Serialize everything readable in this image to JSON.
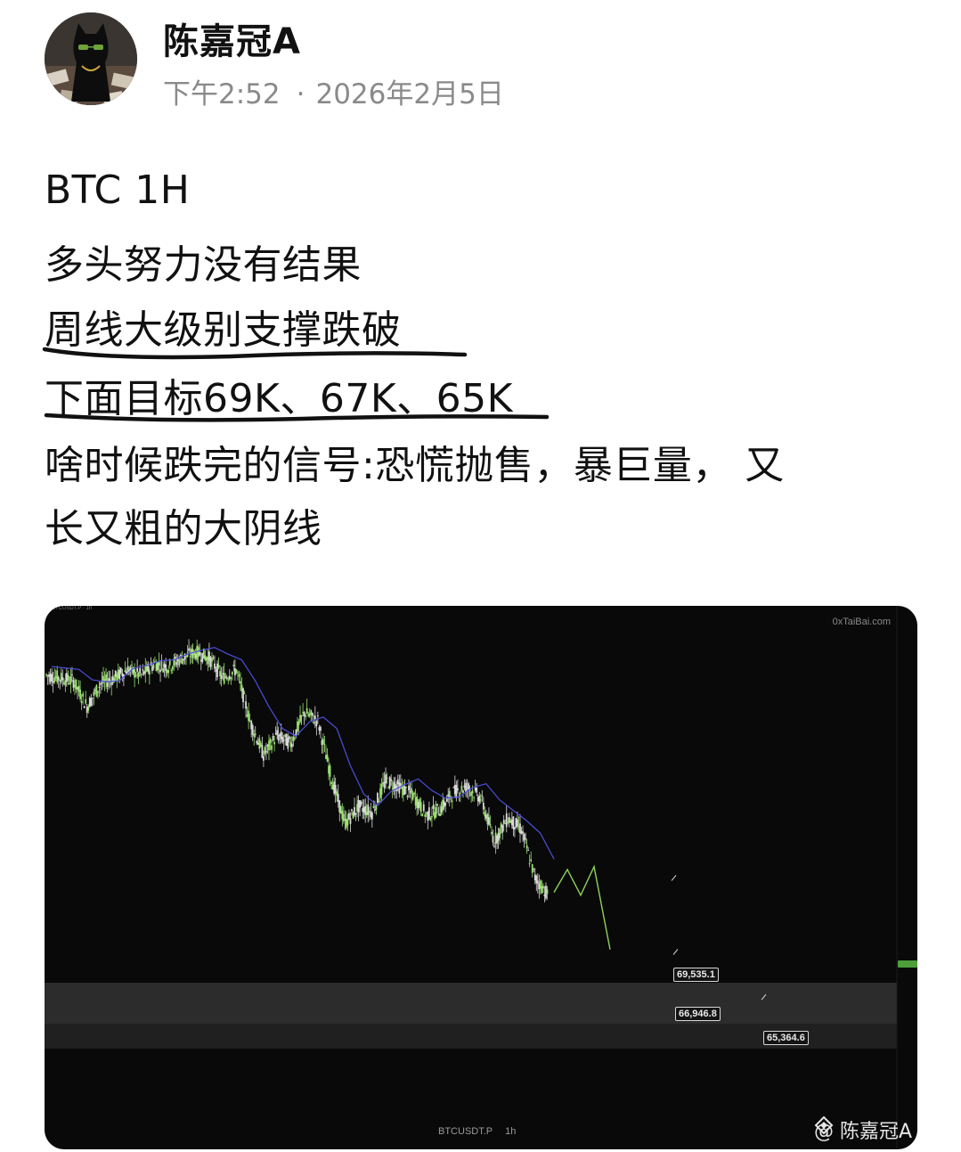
{
  "author": {
    "name": "陈嘉冠A",
    "time": "下午2:52",
    "separator": "·",
    "date": "2026年2月5日"
  },
  "post": {
    "lines": [
      "BTC 1H",
      "多头努力没有结果",
      "周线大级别支撑跌破",
      "下面目标69K、67K、65K",
      "啥时候跌完的信号:恐慌抛售，暴巨量， 又",
      "长又粗的大阴线"
    ]
  },
  "chart": {
    "site_watermark": "0xTaiBai.com",
    "symbol": "BTCUSDT.P",
    "timeframe": "1h",
    "platform_watermark": "@ 陈嘉冠A",
    "levels": [
      "69,535.1",
      "66,946.8",
      "65,364.6"
    ]
  },
  "chart_data": {
    "type": "line",
    "title": "",
    "series": [
      {
        "values": [
          76600,
          76500,
          76400,
          75500,
          76300,
          76500,
          76800,
          76600,
          77000,
          76900,
          77200,
          77400,
          77200,
          76500,
          76800,
          75000,
          73800,
          74500,
          74200,
          75300,
          75000,
          73000,
          71400,
          72000,
          71800,
          72900,
          72700,
          72400,
          71700,
          71900,
          72500,
          72700,
          72300,
          70800,
          71600,
          71200,
          69500,
          68900
        ]
      }
    ],
    "target_levels": [
      69535.1,
      66946.8,
      65364.6
    ],
    "projection": [
      69000,
      69800,
      68900,
      69900,
      67000
    ],
    "colors": {
      "background": "#090909",
      "up": "#9be070",
      "ma": "#4b4fd6",
      "projection": "#8fd35a",
      "zone": "#3a3a3a"
    }
  }
}
